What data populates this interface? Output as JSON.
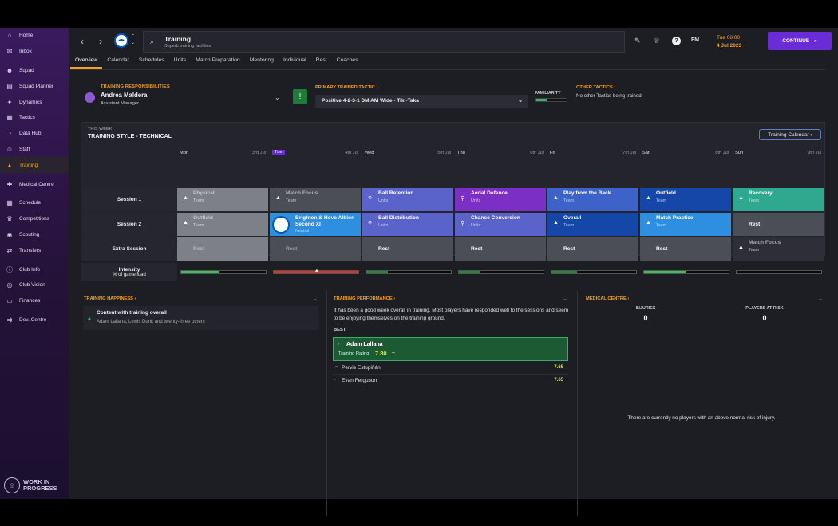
{
  "sidebar": {
    "items": [
      {
        "label": "Home",
        "icon": "home-icon",
        "glyph": "⌂"
      },
      {
        "label": "Inbox",
        "icon": "inbox-icon",
        "glyph": "✉"
      },
      {
        "label": "Squad",
        "icon": "squad-icon",
        "glyph": "☻"
      },
      {
        "label": "Squad Planner",
        "icon": "squad-planner-icon",
        "glyph": "▤"
      },
      {
        "label": "Dynamics",
        "icon": "dynamics-icon",
        "glyph": "✦"
      },
      {
        "label": "Tactics",
        "icon": "tactics-icon",
        "glyph": "▦"
      },
      {
        "label": "Data Hub",
        "icon": "data-hub-icon",
        "glyph": "◔"
      },
      {
        "label": "Staff",
        "icon": "staff-icon",
        "glyph": "☺"
      },
      {
        "label": "Training",
        "icon": "training-icon",
        "glyph": "▲"
      },
      {
        "label": "Medical Centre",
        "icon": "medical-icon",
        "glyph": "✚"
      },
      {
        "label": "Schedule",
        "icon": "schedule-icon",
        "glyph": "▦"
      },
      {
        "label": "Competitions",
        "icon": "competitions-icon",
        "glyph": "♛"
      },
      {
        "label": "Scouting",
        "icon": "scouting-icon",
        "glyph": "◉"
      },
      {
        "label": "Transfers",
        "icon": "transfers-icon",
        "glyph": "⇄"
      },
      {
        "label": "Club Info",
        "icon": "club-info-icon",
        "glyph": "ⓘ"
      },
      {
        "label": "Club Vision",
        "icon": "club-vision-icon",
        "glyph": "◎"
      },
      {
        "label": "Finances",
        "icon": "finances-icon",
        "glyph": "▭"
      },
      {
        "label": "Dev. Centre",
        "icon": "dev-centre-icon",
        "glyph": "⇉"
      }
    ],
    "wip_line1": "WORK IN",
    "wip_line2": "PROGRESS"
  },
  "header": {
    "title": "Training",
    "subtitle": "Superb training facilities",
    "date_line1": "Tue 08:00",
    "date_line2": "4 Jul 2023",
    "fm": "FM",
    "continue": "CONTINUE"
  },
  "tabs": [
    "Overview",
    "Calendar",
    "Schedules",
    "Units",
    "Match Preparation",
    "Mentoring",
    "Individual",
    "Rest",
    "Coaches"
  ],
  "responsibilities": {
    "label": "TRAINING RESPONSIBILITIES",
    "name": "Andrea Maldera",
    "role": "Assistant Manager"
  },
  "tactic": {
    "label": "PRIMARY TRAINED TACTIC ›",
    "value": "Positive 4-2-3-1 DM AM Wide - Tiki-Taka",
    "familiarity_label": "FAMILIARITY",
    "familiarity": 0.35,
    "other_label": "OTHER TACTICS ›",
    "other_text": "No other Tactics being trained"
  },
  "schedule": {
    "week_label": "THIS WEEK",
    "style": "TRAINING STYLE - TECHNICAL",
    "calendar_button": "Training Calendar ›",
    "days": [
      {
        "day": "Mon",
        "date": "3rd Jul"
      },
      {
        "day": "Tue",
        "date": "4th Jul",
        "today": true
      },
      {
        "day": "Wed",
        "date": "5th Jul"
      },
      {
        "day": "Thu",
        "date": "6th Jul"
      },
      {
        "day": "Fri",
        "date": "7th Jul"
      },
      {
        "day": "Sat",
        "date": "8th Jul"
      },
      {
        "day": "Sun",
        "date": "9th Jul"
      }
    ],
    "row_labels": [
      "Session 1",
      "Session 2",
      "Extra Session"
    ],
    "intensity_label_1": "Intensity",
    "intensity_label_2": "% of game load",
    "sessions": [
      [
        {
          "name": "Physical",
          "sub": "Team",
          "color": "#7e8088",
          "dim": true
        },
        {
          "name": "Match Focus",
          "sub": "Team",
          "color": "#4c4e55",
          "dim": true
        },
        {
          "name": "Ball Retention",
          "sub": "Units",
          "color": "#5a63c9"
        },
        {
          "name": "Aerial Defence",
          "sub": "Units",
          "color": "#7c2fc4"
        },
        {
          "name": "Play from the Back",
          "sub": "Team",
          "color": "#3d63c8"
        },
        {
          "name": "Outfield",
          "sub": "Team",
          "color": "#1447a8"
        },
        {
          "name": "Recovery",
          "sub": "Team",
          "color": "#2fa890"
        }
      ],
      [
        {
          "name": "Outfield",
          "sub": "Team",
          "color": "#7e8088",
          "dim": true
        },
        {
          "name": "Brighton & Hove Albion Second XI",
          "sub": "Neutral",
          "color": "#2e8ee0",
          "badge": true
        },
        {
          "name": "Ball Distribution",
          "sub": "Units",
          "color": "#5a63c9"
        },
        {
          "name": "Chance Conversion",
          "sub": "Units",
          "color": "#5a63c9"
        },
        {
          "name": "Overall",
          "sub": "Team",
          "color": "#1447a8"
        },
        {
          "name": "Match Practice",
          "sub": "Team",
          "color": "#2e8ee0"
        },
        {
          "name": "Rest",
          "sub": "",
          "color": "#4c4e55"
        }
      ],
      [
        {
          "name": "Rest",
          "sub": "",
          "color": "#7e8088",
          "rest": true
        },
        {
          "name": "Rest",
          "sub": "",
          "color": "#4c4e55",
          "rest": true
        },
        {
          "name": "Rest",
          "sub": "",
          "color": "#4c4e55"
        },
        {
          "name": "Rest",
          "sub": "",
          "color": "#4c4e55"
        },
        {
          "name": "Rest",
          "sub": "",
          "color": "#4c4e55"
        },
        {
          "name": "Rest",
          "sub": "",
          "color": "#4c4e55"
        },
        {
          "name": "Match Focus",
          "sub": "Team",
          "color": "#2e2f36",
          "dim": true
        }
      ]
    ],
    "intensity": [
      {
        "value": 0.45,
        "color": "#38c25a"
      },
      {
        "value": 1.0,
        "color": "#d8322e",
        "warn": true
      },
      {
        "value": 0.25,
        "color": "#1f8a3c"
      },
      {
        "value": 0.25,
        "color": "#1f8a3c"
      },
      {
        "value": 0.3,
        "color": "#1f8a3c"
      },
      {
        "value": 0.5,
        "color": "#38c25a"
      },
      {
        "value": 0.0,
        "color": "#1f8a3c"
      }
    ]
  },
  "happiness": {
    "title": "TRAINING HAPPINESS ›",
    "row_title": "Content with training overall",
    "row_sub": "Adam Lallana, Lewis Dunk and twenty-three others"
  },
  "performance": {
    "title": "TRAINING PERFORMANCE ›",
    "text": "It has been a good week overall in training. Most players have responded well to the sessions and seem to be enjoying themselves on the training ground.",
    "best_label": "BEST",
    "best_name": "Adam Lallana",
    "best_rating_label": "Training Rating",
    "best_rating": "7.80",
    "others": [
      {
        "name": "Pervis Estupiñán",
        "rating": "7.65"
      },
      {
        "name": "Evan Ferguson",
        "rating": "7.65"
      }
    ]
  },
  "medical": {
    "title": "MEDICAL CENTRE ›",
    "injuries_label": "INJURIES",
    "injuries": "0",
    "risk_label": "PLAYERS AT RISK",
    "risk": "0",
    "note": "There are currently no players with an above normal risk of injury."
  }
}
